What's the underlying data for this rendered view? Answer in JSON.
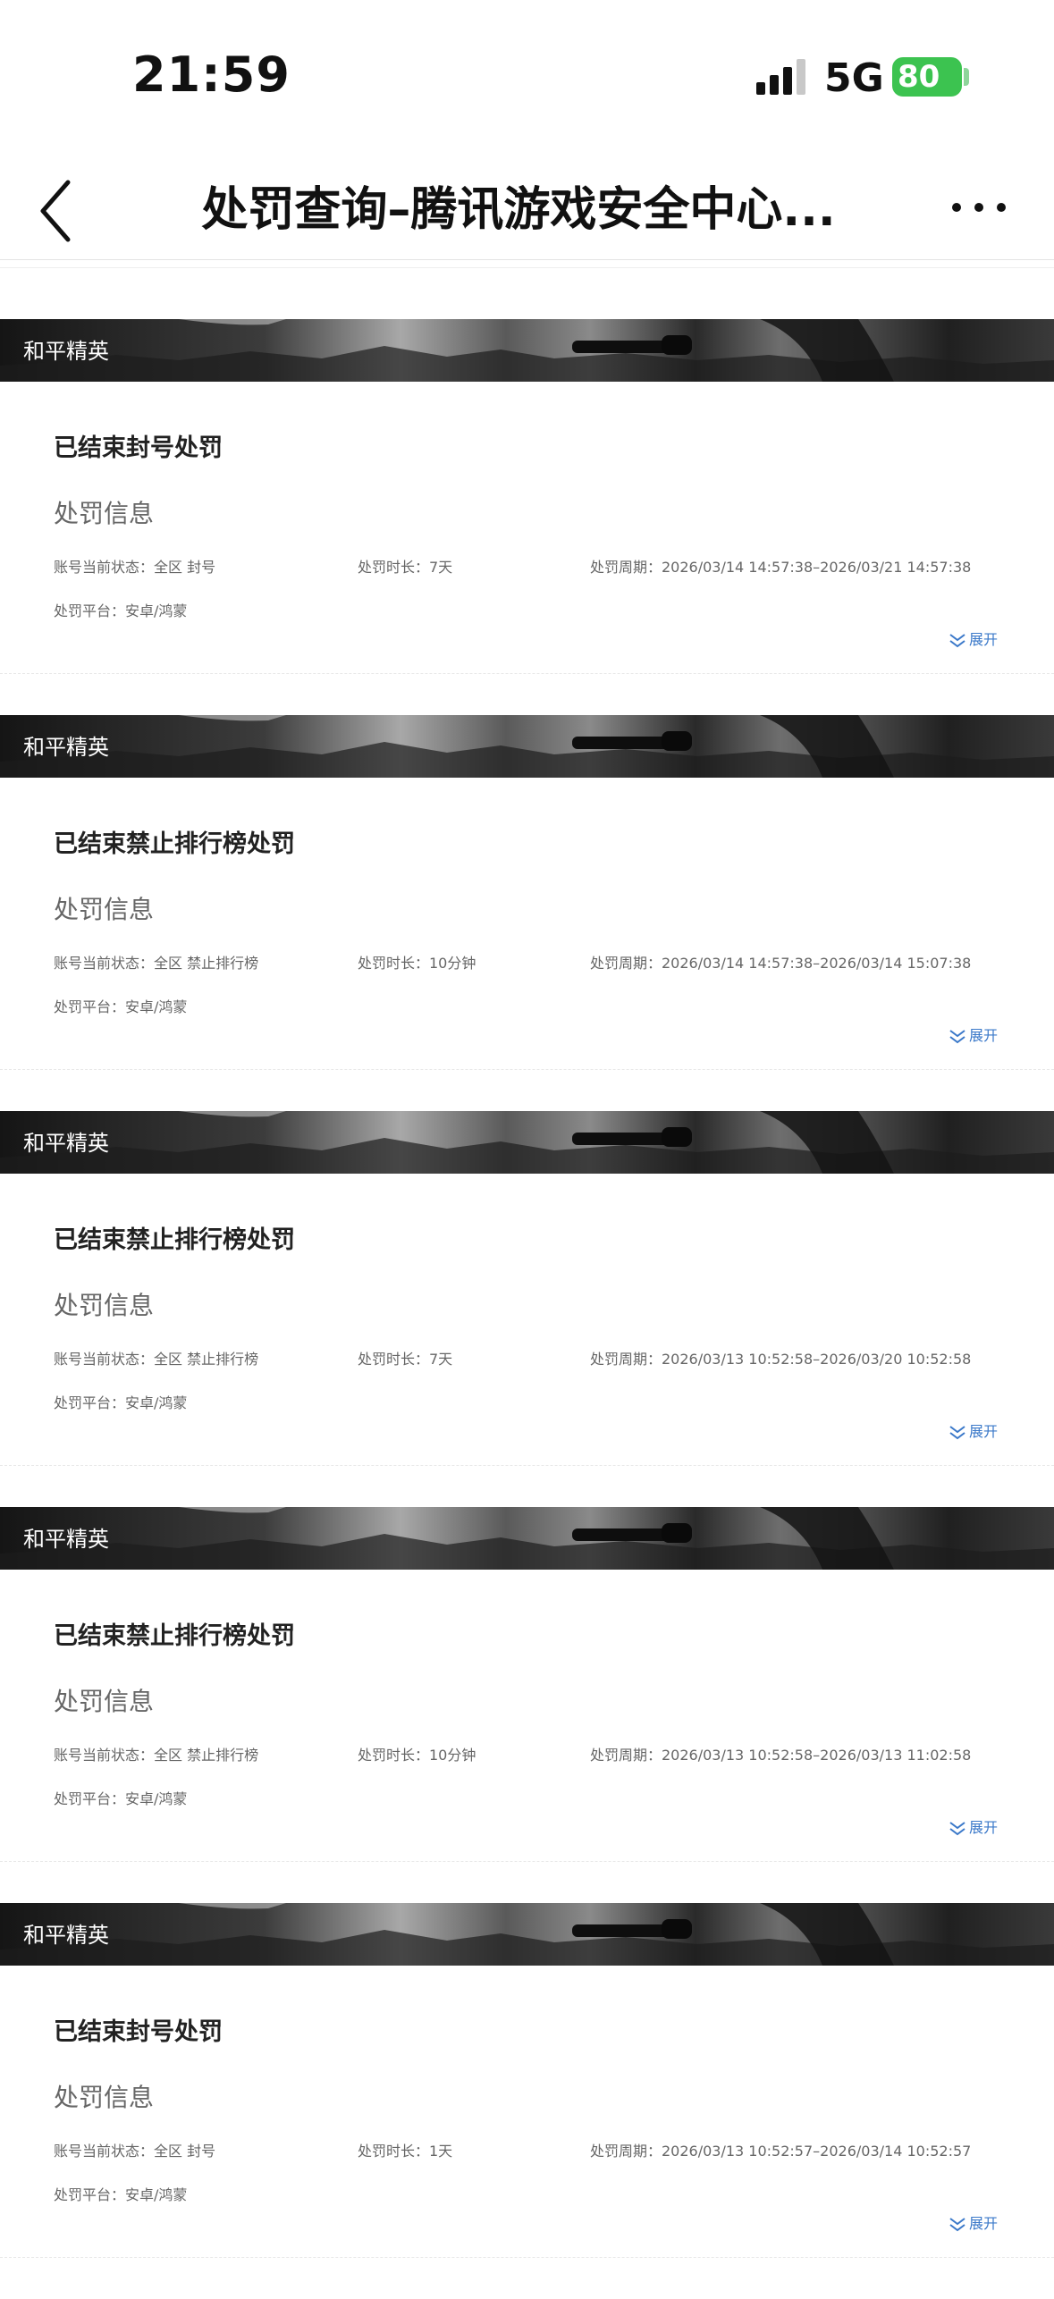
{
  "status_bar": {
    "time": "21:59",
    "network": "5G",
    "battery": "80"
  },
  "nav": {
    "title": "处罚查询–腾讯游戏安全中心..."
  },
  "records": [
    {
      "game": "和平精英",
      "title": "已结束封号处罚",
      "section": "处罚信息",
      "status": "账号当前状态：全区 封号",
      "duration": "处罚时长：7天",
      "period": "处罚周期：2026/03/14 14:57:38–2026/03/21 14:57:38",
      "platform": "处罚平台：安卓/鸿蒙",
      "expand": "展开"
    },
    {
      "game": "和平精英",
      "title": "已结束禁止排行榜处罚",
      "section": "处罚信息",
      "status": "账号当前状态：全区 禁止排行榜",
      "duration": "处罚时长：10分钟",
      "period": "处罚周期：2026/03/14 14:57:38–2026/03/14 15:07:38",
      "platform": "处罚平台：安卓/鸿蒙",
      "expand": "展开"
    },
    {
      "game": "和平精英",
      "title": "已结束禁止排行榜处罚",
      "section": "处罚信息",
      "status": "账号当前状态：全区 禁止排行榜",
      "duration": "处罚时长：7天",
      "period": "处罚周期：2026/03/13 10:52:58–2026/03/20 10:52:58",
      "platform": "处罚平台：安卓/鸿蒙",
      "expand": "展开"
    },
    {
      "game": "和平精英",
      "title": "已结束禁止排行榜处罚",
      "section": "处罚信息",
      "status": "账号当前状态：全区 禁止排行榜",
      "duration": "处罚时长：10分钟",
      "period": "处罚周期：2026/03/13 10:52:58–2026/03/13 11:02:58",
      "platform": "处罚平台：安卓/鸿蒙",
      "expand": "展开"
    },
    {
      "game": "和平精英",
      "title": "已结束封号处罚",
      "section": "处罚信息",
      "status": "账号当前状态：全区 封号",
      "duration": "处罚时长：1天",
      "period": "处罚周期：2026/03/13 10:52:57–2026/03/14 10:52:57",
      "platform": "处罚平台：安卓/鸿蒙",
      "expand": "展开"
    }
  ],
  "colors": {
    "battery": "#3cc350",
    "link": "#3a78c9",
    "title_text": "#222222",
    "secondary_text": "#666666"
  },
  "icons": {
    "back": "chevron-left-icon",
    "more": "more-horizontal-icon",
    "signal": "cellular-signal-icon",
    "expand": "double-chevron-down-icon"
  }
}
